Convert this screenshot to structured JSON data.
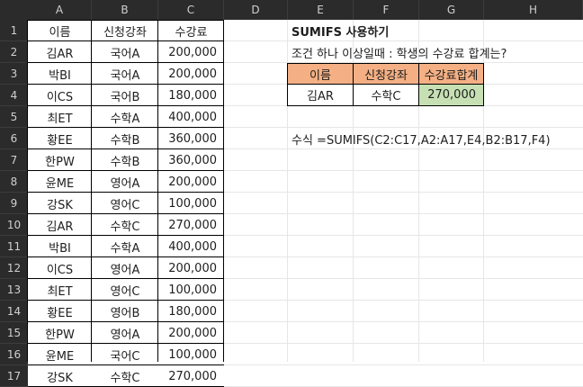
{
  "columns": [
    "A",
    "B",
    "C",
    "D",
    "E",
    "F",
    "G",
    "H"
  ],
  "rows": [
    "1",
    "2",
    "3",
    "4",
    "5",
    "6",
    "7",
    "8",
    "9",
    "10",
    "11",
    "12",
    "13",
    "14",
    "15",
    "16",
    "17"
  ],
  "table": {
    "headers": [
      "이름",
      "신청강좌",
      "수강료"
    ],
    "data": [
      [
        "김AR",
        "국어A",
        "200,000"
      ],
      [
        "박BI",
        "국어A",
        "200,000"
      ],
      [
        "이CS",
        "국어B",
        "180,000"
      ],
      [
        "최ET",
        "수학A",
        "400,000"
      ],
      [
        "황EE",
        "수학B",
        "360,000"
      ],
      [
        "한PW",
        "수학B",
        "360,000"
      ],
      [
        "윤ME",
        "영어A",
        "200,000"
      ],
      [
        "강SK",
        "영어C",
        "100,000"
      ],
      [
        "김AR",
        "수학C",
        "270,000"
      ],
      [
        "박BI",
        "수학A",
        "400,000"
      ],
      [
        "이CS",
        "영어A",
        "200,000"
      ],
      [
        "최ET",
        "영어C",
        "100,000"
      ],
      [
        "황EE",
        "영어B",
        "180,000"
      ],
      [
        "한PW",
        "영어A",
        "200,000"
      ],
      [
        "윤ME",
        "국어C",
        "100,000"
      ],
      [
        "강SK",
        "수학C",
        "270,000"
      ]
    ]
  },
  "title": "SUMIFS 사용하기",
  "question": "조건 하나 이상일때 : 학생의 수강료 합계는?",
  "criteria": {
    "headers": [
      "이름",
      "신청강좌",
      "수강료합계"
    ],
    "values": [
      "김AR",
      "수학C",
      "270,000"
    ]
  },
  "formula": "수식 =SUMIFS(C2:C17,A2:A17,E4,B2:B17,F4)",
  "colors": {
    "header_bg": "#2b2b2b",
    "header_text": "#d0d0d0",
    "criteria_header_bg": "#f4b084",
    "result_bg": "#c6e0b4"
  }
}
